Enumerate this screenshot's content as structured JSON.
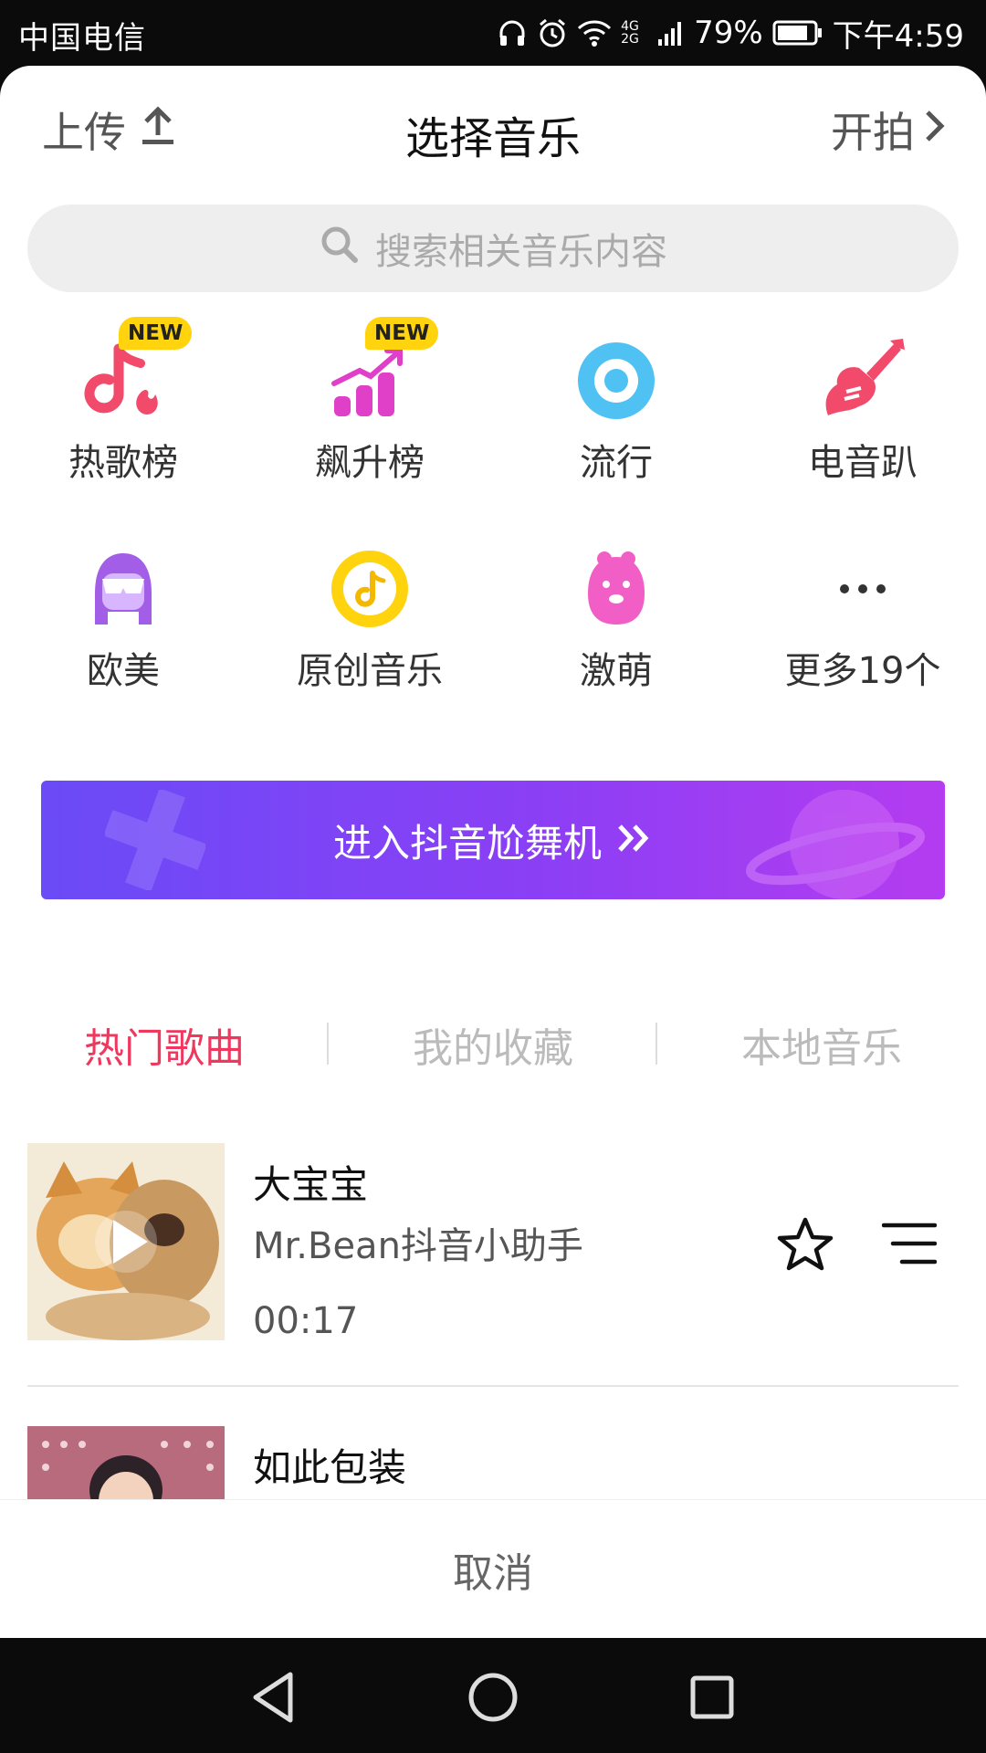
{
  "status_bar": {
    "carrier": "中国电信",
    "network": "4G 2G",
    "battery": "79%",
    "time": "下午4:59"
  },
  "header": {
    "upload_label": "上传",
    "title": "选择音乐",
    "start_label": "开拍"
  },
  "search": {
    "placeholder": "搜索相关音乐内容"
  },
  "categories": [
    {
      "label": "热歌榜",
      "badge": "NEW",
      "icon": "hot-songs-note-flame-icon"
    },
    {
      "label": "飙升榜",
      "badge": "NEW",
      "icon": "rising-chart-icon"
    },
    {
      "label": "流行",
      "icon": "disc-icon"
    },
    {
      "label": "电音趴",
      "icon": "electric-guitar-icon"
    },
    {
      "label": "欧美",
      "icon": "western-girl-sunglasses-icon"
    },
    {
      "label": "原创音乐",
      "icon": "original-music-note-icon"
    },
    {
      "label": "激萌",
      "icon": "cute-creature-icon"
    },
    {
      "label": "更多19个",
      "icon": "more-dots-icon"
    }
  ],
  "banner": {
    "label": "进入抖音尬舞机"
  },
  "tabs": [
    {
      "label": "热门歌曲",
      "active": true
    },
    {
      "label": "我的收藏",
      "active": false
    },
    {
      "label": "本地音乐",
      "active": false
    }
  ],
  "songs": [
    {
      "title": "大宝宝",
      "artist": "Mr.Bean抖音小助手",
      "duration": "00:17"
    },
    {
      "title": "如此包装",
      "artist": "",
      "duration": ""
    }
  ],
  "footer": {
    "cancel_label": "取消"
  },
  "colors": {
    "accent": "#f0375e",
    "banner_start": "#6a4bf6",
    "banner_end": "#b53cf0",
    "badge": "#ffd30e"
  }
}
